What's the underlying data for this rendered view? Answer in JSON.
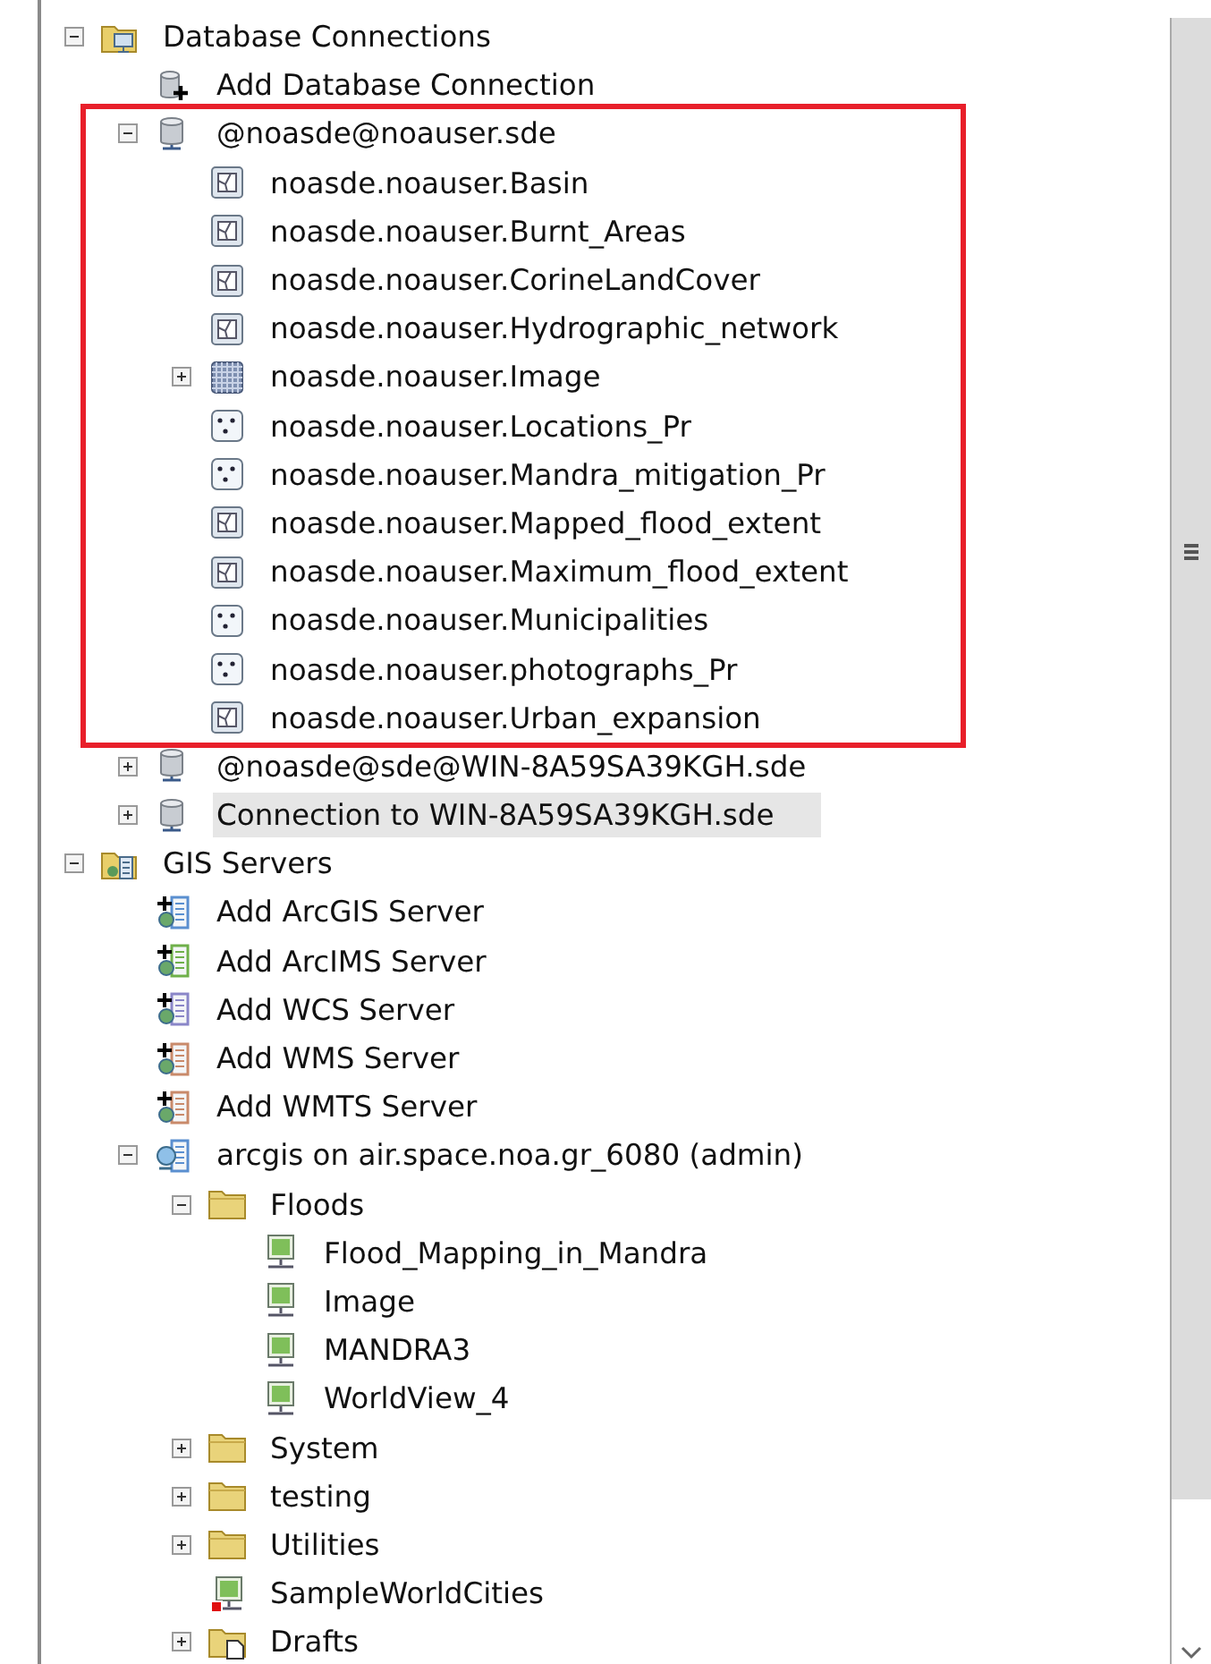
{
  "tree": [
    {
      "label": "Database Connections",
      "kind": "db-folder",
      "expanded": true,
      "selected": false,
      "children": [
        {
          "label": "Add Database Connection",
          "kind": "db-add",
          "selected": false
        },
        {
          "label": "@noasde@noauser.sde",
          "kind": "database",
          "expanded": true,
          "selected": false,
          "highlighted": true,
          "children": [
            {
              "label": "noasde.noauser.Basin",
              "kind": "polygon",
              "selected": false
            },
            {
              "label": "noasde.noauser.Burnt_Areas",
              "kind": "polygon",
              "selected": false
            },
            {
              "label": "noasde.noauser.CorineLandCover",
              "kind": "polygon",
              "selected": false
            },
            {
              "label": "noasde.noauser.Hydrographic_network",
              "kind": "polygon",
              "selected": false
            },
            {
              "label": "noasde.noauser.Image",
              "kind": "raster",
              "expanded": false,
              "selected": false
            },
            {
              "label": "noasde.noauser.Locations_Pr",
              "kind": "point",
              "selected": false
            },
            {
              "label": "noasde.noauser.Mandra_mitigation_Pr",
              "kind": "point",
              "selected": false
            },
            {
              "label": "noasde.noauser.Mapped_flood_extent",
              "kind": "polygon",
              "selected": false
            },
            {
              "label": "noasde.noauser.Maximum_flood_extent",
              "kind": "polygon",
              "selected": false
            },
            {
              "label": "noasde.noauser.Municipalities",
              "kind": "point",
              "selected": false
            },
            {
              "label": "noasde.noauser.photographs_Pr",
              "kind": "point",
              "selected": false
            },
            {
              "label": "noasde.noauser.Urban_expansion",
              "kind": "polygon",
              "selected": false
            }
          ]
        },
        {
          "label": "@noasde@sde@WIN-8A59SA39KGH.sde",
          "kind": "database",
          "expanded": false,
          "selected": false,
          "highlighted": false
        },
        {
          "label": "Connection to WIN-8A59SA39KGH.sde",
          "kind": "database",
          "expanded": false,
          "selected": true,
          "highlighted": false
        }
      ]
    },
    {
      "label": "GIS Servers",
      "kind": "server-folder",
      "expanded": true,
      "selected": false,
      "children": [
        {
          "label": "Add ArcGIS Server",
          "kind": "server-add",
          "color": "#5a8fd0",
          "selected": false
        },
        {
          "label": "Add ArcIMS Server",
          "kind": "server-add",
          "color": "#6fb04a",
          "selected": false
        },
        {
          "label": "Add WCS Server",
          "kind": "server-add",
          "color": "#8a86c8",
          "selected": false
        },
        {
          "label": "Add WMS Server",
          "kind": "server-add",
          "color": "#c98a6a",
          "selected": false
        },
        {
          "label": "Add WMTS Server",
          "kind": "server-add",
          "color": "#c98a6a",
          "selected": false
        },
        {
          "label": "arcgis on air.space.noa.gr_6080 (admin)",
          "kind": "server",
          "expanded": true,
          "selected": false,
          "children": [
            {
              "label": "Floods",
              "kind": "folder",
              "expanded": true,
              "selected": false,
              "children": [
                {
                  "label": "Flood_Mapping_in_Mandra",
                  "kind": "map-service",
                  "selected": false
                },
                {
                  "label": "Image",
                  "kind": "map-service",
                  "selected": false
                },
                {
                  "label": "MANDRA3",
                  "kind": "map-service",
                  "selected": false
                },
                {
                  "label": "WorldView_4",
                  "kind": "map-service",
                  "selected": false
                }
              ]
            },
            {
              "label": "System",
              "kind": "folder",
              "expanded": false,
              "selected": false
            },
            {
              "label": "testing",
              "kind": "folder",
              "expanded": false,
              "selected": false
            },
            {
              "label": "Utilities",
              "kind": "folder",
              "expanded": false,
              "selected": false
            },
            {
              "label": "SampleWorldCities",
              "kind": "map-service-stopped",
              "selected": false
            },
            {
              "label": "Drafts",
              "kind": "drafts-folder",
              "expanded": false,
              "selected": false
            }
          ]
        }
      ]
    }
  ]
}
